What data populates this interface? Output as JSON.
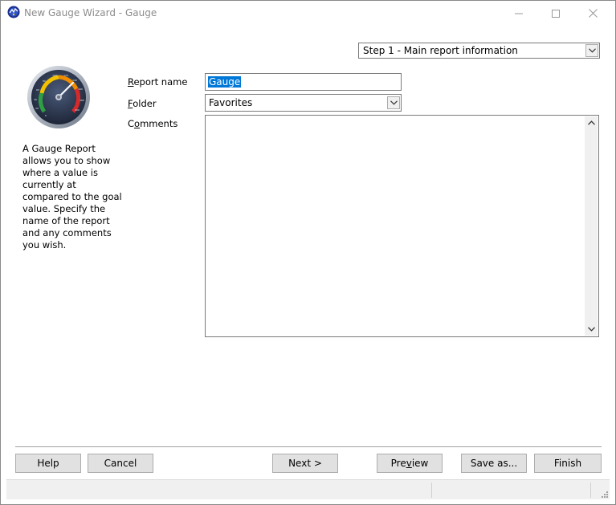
{
  "window": {
    "title": "New Gauge Wizard - Gauge",
    "minimize_icon": "minimize-icon",
    "maximize_icon": "maximize-icon",
    "close_icon": "close-icon"
  },
  "step": {
    "selected": "Step 1 - Main report information"
  },
  "description": "A Gauge Report allows you to show where a value is currently at compared to the goal value. Specify the name of the report and any comments you wish.",
  "form": {
    "report_name_label_first": "R",
    "report_name_label_rest": "eport name",
    "report_name_value": "Gauge",
    "folder_label_first": "F",
    "folder_label_rest": "older",
    "folder_value": "Favorites",
    "comments_label_pre": "C",
    "comments_label_under": "o",
    "comments_label_rest": "mments",
    "comments_value": ""
  },
  "buttons": {
    "help": "Help",
    "cancel": "Cancel",
    "next": "Next >",
    "preview_pre": "Pre",
    "preview_under": "v",
    "preview_rest": "iew",
    "save_as": "Save as...",
    "finish": "Finish"
  },
  "gauge_image": {
    "tick_labels": [
      "0",
      "20",
      "40",
      "60",
      "80",
      "100",
      "120",
      "140",
      "160",
      "180",
      "200"
    ]
  },
  "colors": {
    "selection": "#0078d7",
    "button_face": "#e1e1e1",
    "status_bar": "#f0f0f0"
  }
}
